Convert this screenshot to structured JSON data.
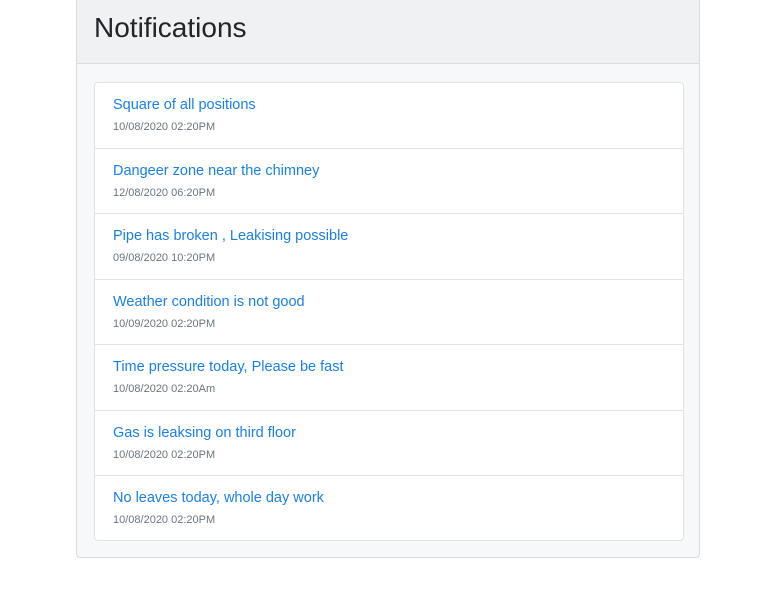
{
  "header": {
    "title": "Notifications"
  },
  "notifications": [
    {
      "title": "Square of all positions",
      "time": "10/08/2020 02:20PM"
    },
    {
      "title": "Dangeer zone near the chimney",
      "time": "12/08/2020 06:20PM"
    },
    {
      "title": "Pipe has broken , Leakising possible",
      "time": "09/08/2020 10:20PM"
    },
    {
      "title": "Weather condition is not good",
      "time": "10/09/2020 02:20PM"
    },
    {
      "title": "Time pressure today, Please be fast",
      "time": "10/08/2020 02:20Am"
    },
    {
      "title": "Gas is leaksing on third floor",
      "time": "10/08/2020 02:20PM"
    },
    {
      "title": "No leaves today, whole day work",
      "time": "10/08/2020 02:20PM"
    }
  ],
  "colors": {
    "link": "#1a80e6",
    "muted": "#6c757d",
    "header_bg": "#f0f1f2"
  }
}
